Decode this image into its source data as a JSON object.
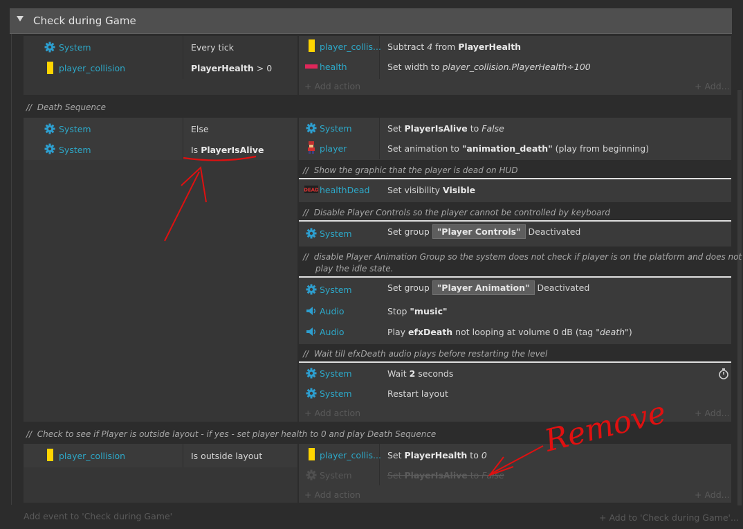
{
  "group": {
    "title": "Check during Game"
  },
  "event1": {
    "conditions": [
      {
        "object": "System",
        "text": "Every tick"
      },
      {
        "object": "player_collision",
        "text_bold": "PlayerHealth",
        "text_rest": " > 0"
      }
    ],
    "actions": [
      {
        "object": "player_collis...",
        "prefix": "Subtract ",
        "italic": "4",
        "mid": " from ",
        "bold": "PlayerHealth"
      },
      {
        "object": "health",
        "prefix": "Set width to ",
        "italic": "player_collision.PlayerHealth÷100"
      }
    ],
    "add_action": "+ Add action",
    "add_more": "+ Add..."
  },
  "comment_death": "Death Sequence",
  "event2": {
    "conditions": [
      {
        "object": "System",
        "text": "Else"
      },
      {
        "object": "System",
        "prefix": "Is ",
        "bold": "PlayerIsAlive"
      }
    ],
    "actions_a": [
      {
        "object": "System",
        "prefix": "Set ",
        "bold": "PlayerIsAlive",
        "mid": " to ",
        "italic": "False"
      },
      {
        "object": "player",
        "prefix": "Set animation to ",
        "bold": "\"animation_death\"",
        "rest": " (play from beginning)"
      }
    ],
    "comment_hud": "Show the graphic that the player is dead on HUD",
    "action_hud": {
      "object": "healthDead",
      "prefix": "Set visibility ",
      "bold": "Visible"
    },
    "hud_icon_text": "DEAD",
    "comment_controls": "Disable Player Controls so the player cannot be controlled by keyboard",
    "action_controls": {
      "object": "System",
      "prefix": "Set group ",
      "badge": "\"Player Controls\"",
      "rest": " Deactivated"
    },
    "comment_anim_1": "disable Player Animation Group so the system does not check if player is on the platform and does not",
    "comment_anim_2": "play the idle state.",
    "actions_anim": [
      {
        "object": "System",
        "prefix": "Set group ",
        "badge": "\"Player Animation\"",
        "rest": " Deactivated"
      },
      {
        "object": "Audio",
        "prefix": "Stop ",
        "bold": "\"music\""
      },
      {
        "object": "Audio",
        "prefix": "Play ",
        "bold": "efxDeath",
        "rest": " not looping at volume 0 dB (tag ",
        "italic": "\"death\"",
        "end": ")"
      }
    ],
    "comment_wait": "Wait till efxDeath audio plays before restarting the level",
    "actions_wait": [
      {
        "object": "System",
        "prefix": "Wait ",
        "bold": "2",
        "rest": " seconds"
      },
      {
        "object": "System",
        "text": "Restart layout"
      }
    ],
    "add_action": "+ Add action",
    "add_more": "+ Add..."
  },
  "comment_outside": "Check to see if Player is outside layout - if yes - set player health to 0 and play Death Sequence",
  "event3": {
    "condition": {
      "object": "player_collision",
      "text": "Is outside layout"
    },
    "actions": [
      {
        "object": "player_collis...",
        "prefix": "Set ",
        "bold": "PlayerHealth",
        "mid": " to ",
        "italic": "0"
      },
      {
        "object": "System",
        "prefix": "Set ",
        "bold": "PlayerIsAlive",
        "mid": " to ",
        "italic": "False"
      }
    ],
    "add_action": "+ Add action",
    "add_more": "+ Add..."
  },
  "footer": {
    "add_event": "Add event to 'Check during Game'",
    "add_to": "+ Add to 'Check during Game'..."
  },
  "annotations": {
    "remove_label": "Remove",
    "color": "#e01010"
  },
  "colors": {
    "object_link": "#2da8c8",
    "variable_icon": "#ffd400",
    "sprite_icon": "#e0275a"
  }
}
